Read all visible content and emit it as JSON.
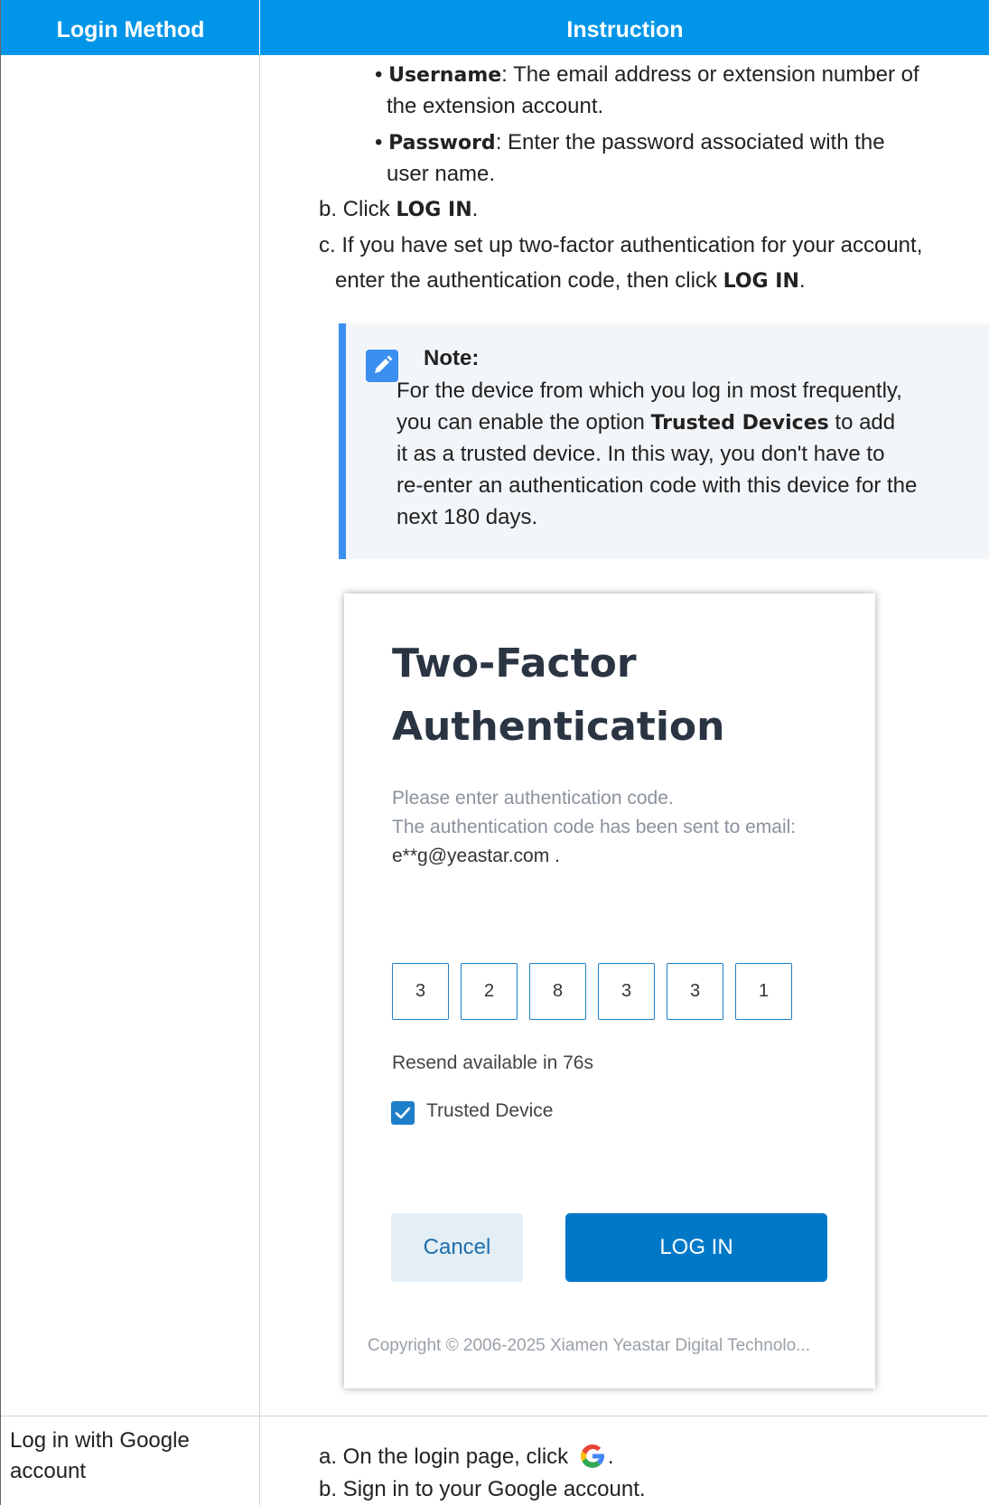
{
  "table": {
    "header": {
      "col1": "Login Method",
      "col2": "Instruction"
    },
    "row1": {
      "bullets": [
        {
          "term": "Username",
          "text_line1": ": The email address or extension number of",
          "text_line2": "the extension account."
        },
        {
          "term": "Password",
          "text_line1": ": Enter the password associated with the",
          "text_line2": "user name."
        }
      ],
      "step_b": {
        "prefix": "b. Click ",
        "bold": "LOG IN",
        "suffix": "."
      },
      "step_c": {
        "line1": "c. If you have set up two-factor authentication for your account,",
        "line2_prefix": "enter the authentication code, then click ",
        "line2_bold": "LOG IN",
        "line2_suffix": "."
      },
      "note": {
        "title": "Note:",
        "line1": "For the device from which you log in most frequently,",
        "line2_prefix": "you can enable the option ",
        "line2_bold": "Trusted Devices",
        "line2_suffix": " to add",
        "line3": "it as a trusted device. In this way, you don't have to",
        "line4": "re-enter an authentication code with this device for the",
        "line5": "next 180 days."
      },
      "screenshot": {
        "title_line1": "Two-Factor",
        "title_line2": "Authentication",
        "msg_line1": "Please enter authentication code.",
        "msg_line2": "The authentication code has been sent to email:",
        "email": "e**g@yeastar.com .",
        "code_digits": [
          "3",
          "2",
          "8",
          "3",
          "3",
          "1"
        ],
        "resend": "Resend available in 76s",
        "trusted_device_label": "Trusted Device",
        "trusted_device_checked": true,
        "cancel_label": "Cancel",
        "login_label": "LOG IN",
        "copyright": "Copyright © 2006-2025 Xiamen Yeastar Digital Technolo..."
      }
    },
    "row2": {
      "method_line1": "Log in with Google",
      "method_line2": "account",
      "step_a_text": "a. On the login page, click ",
      "step_a_suffix": ".",
      "step_b_text": "b. Sign in to your Google account."
    }
  },
  "colors": {
    "header_bg": "#0095e8",
    "note_accent": "#3b8ff0",
    "primary_button": "#0078c8",
    "digit_border": "#1e7fc9"
  }
}
